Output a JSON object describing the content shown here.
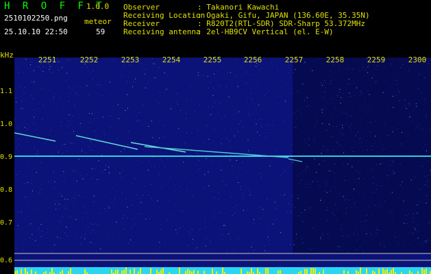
{
  "app": {
    "title": "H R O F F T",
    "version": "1.0.0"
  },
  "file": {
    "name": "2510102250.png",
    "datetime": "25.10.10 22:50"
  },
  "meteor": {
    "label": "meteor",
    "count": "59"
  },
  "info": [
    {
      "key": "Observer",
      "value": ": Takanori Kawachi"
    },
    {
      "key": "Receiving Location",
      "value": ": Ogaki, Gifu, JAPAN (136.60E, 35.35N)"
    },
    {
      "key": "Receiver",
      "value": ": R820T2(RTL-SDR) SDR-Sharp 53.372MHz"
    },
    {
      "key": "Receiving antenna",
      "value": ": 2el-HB9CV Vertical (el. E-W)"
    }
  ],
  "axis": {
    "y_unit": "kHz",
    "y_ticks": [
      "1.1",
      "1.0",
      "0.9",
      "0.8",
      "0.7",
      "0.6"
    ],
    "x_ticks": [
      "2251",
      "2252",
      "2253",
      "2254",
      "2255",
      "2256",
      "2257",
      "2258",
      "2259",
      "2300"
    ]
  },
  "colors": {
    "background": "#0a0f73",
    "carrier": "#40f0f0",
    "label": "#e0e000",
    "title": "#00ff00"
  }
}
